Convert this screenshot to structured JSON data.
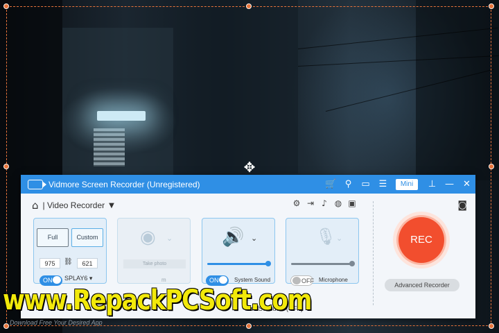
{
  "window": {
    "title": "Vidmore Screen Recorder (Unregistered)",
    "mini_label": "Mini",
    "titlebar_icons": [
      "cart-icon",
      "key-icon",
      "message-icon",
      "menu-icon",
      "pin-icon",
      "minimize-icon",
      "close-icon"
    ]
  },
  "mode": {
    "label": "| Video Recorder"
  },
  "tools": [
    "settings-icon",
    "export-icon",
    "audio-icon",
    "mouse-icon",
    "fps-icon"
  ],
  "display_panel": {
    "full_label": "Full",
    "custom_label": "Custom",
    "width": "975",
    "height": "621",
    "toggle_label": "ON",
    "display_select": "SPLAY6"
  },
  "webcam_panel": {
    "take_photo_label": "Take photo",
    "partial_label": "m"
  },
  "sound_panel": {
    "toggle_label": "ON",
    "label": "System Sound",
    "level": 1.0
  },
  "mic_panel": {
    "toggle_label": "OFF",
    "label": "Microphone",
    "level": 1.0
  },
  "rec": {
    "label": "REC",
    "advanced_label": "Advanced Recorder"
  },
  "task_schedule": "Task Schedule (OFF)",
  "watermark": {
    "text": "www.RepackPCSoft.com",
    "subtext": "Download Free Your Desired App"
  },
  "colors": {
    "accent": "#2f8fe5",
    "rec": "#f24e2e",
    "frame": "#e8743b",
    "watermark": "#f2e90b"
  }
}
